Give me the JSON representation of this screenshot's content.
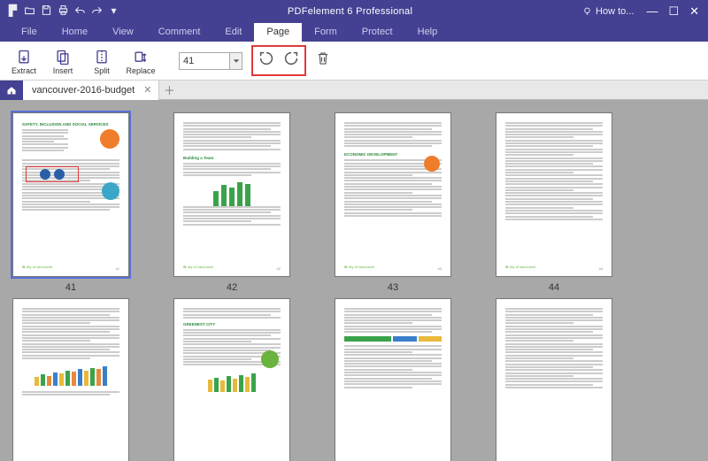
{
  "app": {
    "title": "PDFelement 6 Professional"
  },
  "howto": {
    "label": "How to..."
  },
  "menu": {
    "items": [
      "File",
      "Home",
      "View",
      "Comment",
      "Edit",
      "Page",
      "Form",
      "Protect",
      "Help"
    ],
    "active": "Page"
  },
  "ribbon": {
    "extract": "Extract",
    "insert": "Insert",
    "split": "Split",
    "replace": "Replace",
    "page_value": "41"
  },
  "tab": {
    "name": "vancouver-2016-budget"
  },
  "pages": {
    "row1": [
      "41",
      "42",
      "43",
      "44"
    ],
    "selected": "41"
  }
}
